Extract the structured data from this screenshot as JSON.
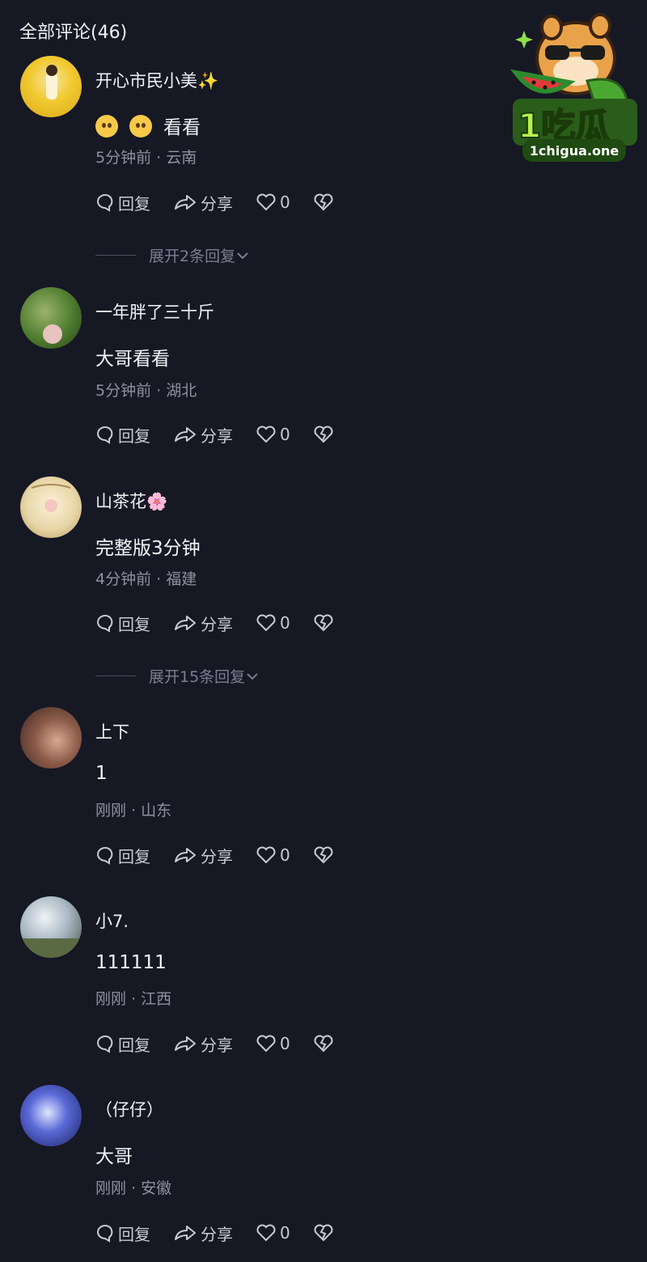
{
  "header": {
    "title": "全部评论(46)"
  },
  "logo": {
    "brand": "1吃瓜",
    "url_text": "1chigua.one"
  },
  "actions": {
    "reply": "回复",
    "share": "分享",
    "like_count": "0"
  },
  "comments": [
    {
      "username": "开心市民小美",
      "name_suffix": "✨",
      "content": "看看",
      "time": "5分钟前",
      "location": "云南",
      "expand": "展开2条回复"
    },
    {
      "username": "一年胖了三十斤",
      "name_suffix": "",
      "content": "大哥看看",
      "time": "5分钟前",
      "location": "湖北",
      "expand": ""
    },
    {
      "username": "山茶花",
      "name_suffix": "🌸",
      "content": "完整版3分钟",
      "time": "4分钟前",
      "location": "福建",
      "expand": "展开15条回复"
    },
    {
      "username": "上下",
      "name_suffix": "",
      "content": "1",
      "time": "刚刚",
      "location": "山东",
      "expand": ""
    },
    {
      "username": "小7.",
      "name_suffix": "",
      "content": "111111",
      "time": "刚刚",
      "location": "江西",
      "expand": ""
    },
    {
      "username": "（仔仔）",
      "name_suffix": "",
      "content": "大哥",
      "time": "刚刚",
      "location": "安徽",
      "expand": ""
    }
  ],
  "colors": {
    "background": "#161824",
    "text": "#e9e9ee",
    "muted": "#8e90a0"
  }
}
